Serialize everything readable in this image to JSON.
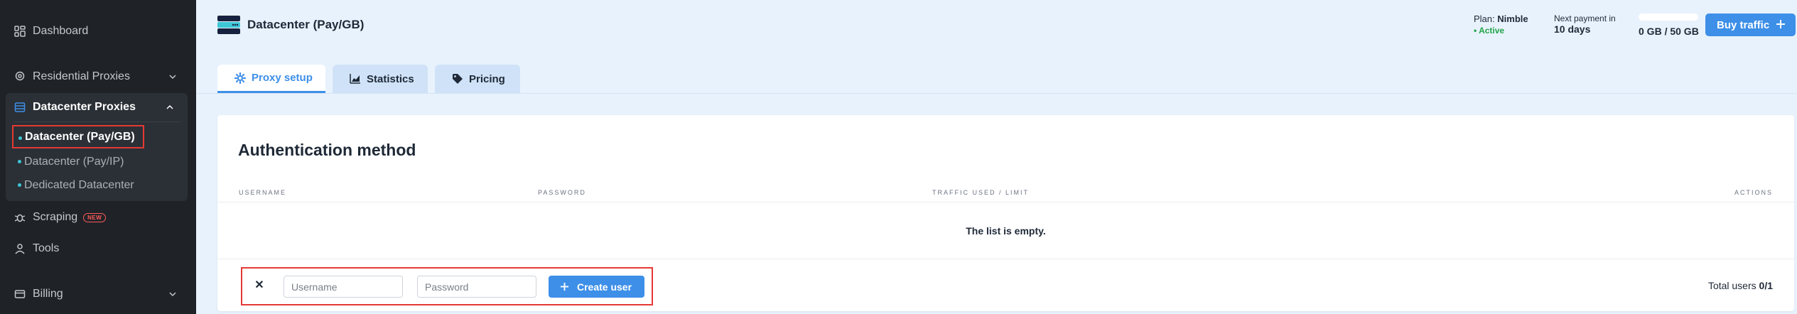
{
  "sidebar": {
    "dashboard": "Dashboard",
    "residential": "Residential Proxies",
    "datacenter_group": "Datacenter Proxies",
    "datacenter_items": [
      "Datacenter (Pay/GB)",
      "Datacenter (Pay/IP)",
      "Dedicated Datacenter"
    ],
    "scraping": "Scraping",
    "scraping_badge": "NEW",
    "tools": "Tools",
    "billing": "Billing"
  },
  "header": {
    "title": "Datacenter (Pay/GB)",
    "plan_label": "Plan:",
    "plan_name": "Nimble",
    "plan_status": "• Active",
    "payment_label": "Next payment in",
    "payment_value": "10 days",
    "traffic_value": "0 GB / 50 GB",
    "traffic_fraction": 0,
    "buy_label": "Buy traffic"
  },
  "tabs": [
    {
      "label": "Proxy setup",
      "icon": "gear-icon",
      "active": true
    },
    {
      "label": "Statistics",
      "icon": "chart-icon",
      "active": false
    },
    {
      "label": "Pricing",
      "icon": "tag-icon",
      "active": false
    }
  ],
  "auth": {
    "title": "Authentication method",
    "columns": [
      "USERNAME",
      "PASSWORD",
      "TRAFFIC USED / LIMIT",
      "ACTIONS"
    ],
    "empty_text": "The list is empty.",
    "username_placeholder": "Username",
    "password_placeholder": "Password",
    "create_label": "Create user",
    "total_label": "Total users",
    "total_value": "0/1"
  },
  "colors": {
    "accent": "#3d8fe8",
    "sidebar_bg": "#1f2328",
    "highlight": "#e53935",
    "active_status": "#22a447"
  }
}
